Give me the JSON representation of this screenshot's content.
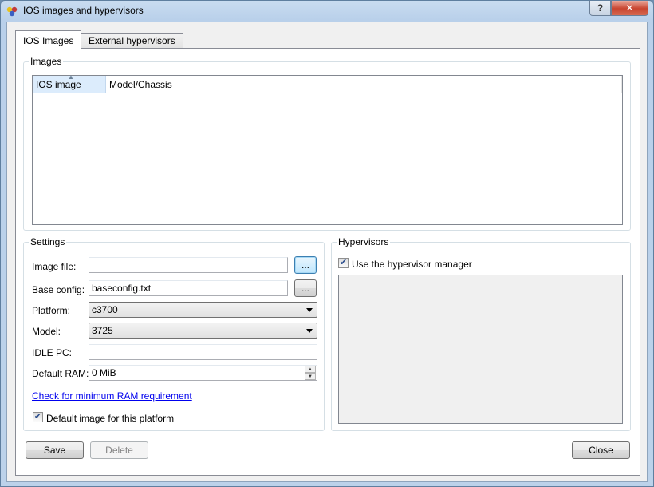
{
  "window": {
    "title": "IOS images and hypervisors",
    "help_glyph": "?",
    "close_glyph": "✕"
  },
  "tabs": [
    {
      "label": "IOS Images",
      "active": true
    },
    {
      "label": "External hypervisors",
      "active": false
    }
  ],
  "images": {
    "group_title": "Images",
    "columns": [
      "IOS image",
      "Model/Chassis"
    ],
    "rows": []
  },
  "settings": {
    "group_title": "Settings",
    "image_file": {
      "label": "Image file:",
      "value": "",
      "browse_label": "..."
    },
    "base_config": {
      "label": "Base config:",
      "value": "baseconfig.txt",
      "browse_label": "..."
    },
    "platform": {
      "label": "Platform:",
      "value": "c3700"
    },
    "model": {
      "label": "Model:",
      "value": "3725"
    },
    "idle_pc": {
      "label": "IDLE PC:",
      "value": ""
    },
    "default_ram": {
      "label": "Default RAM:",
      "value": "0 MiB"
    },
    "ram_link": "Check for minimum RAM requirement",
    "default_image": {
      "label": "Default image for this platform",
      "checked": true
    }
  },
  "hypervisors": {
    "group_title": "Hypervisors",
    "use_manager": {
      "label": "Use the hypervisor manager",
      "checked": true
    }
  },
  "buttons": {
    "save": "Save",
    "delete": "Delete",
    "close": "Close"
  },
  "check_glyph": "✔"
}
